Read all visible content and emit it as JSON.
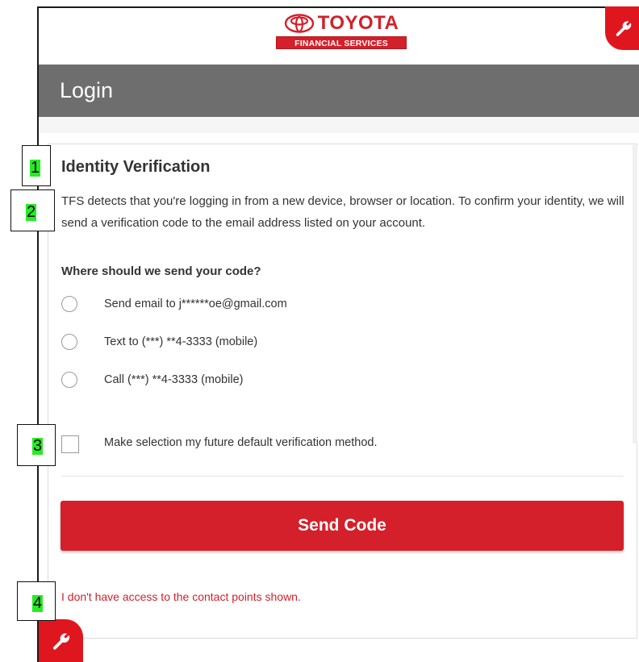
{
  "logo": {
    "brand": "TOYOTA",
    "sub": "FINANCIAL SERVICES"
  },
  "header": {
    "title": "Login"
  },
  "verification": {
    "heading": "Identity Verification",
    "description": "TFS detects that you're logging in from a new device, browser or location. To confirm your identity, we will send a verification code to the email address listed on your account.",
    "question": "Where should we send your code?",
    "options": [
      {
        "label": "Send email to j******oe@gmail.com"
      },
      {
        "label": "Text to (***) **4-3333 (mobile)"
      },
      {
        "label": "Call (***) **4-3333 (mobile)"
      }
    ],
    "default_checkbox_label": "Make selection my future default verification method.",
    "send_button": "Send Code",
    "no_access_link": "I don't have access to the contact points shown."
  },
  "callouts": [
    "1",
    "2",
    "3",
    "4"
  ],
  "icons": {
    "wrench_top": "wrench-icon",
    "wrench_bottom": "wrench-icon",
    "logo": "toyota-emblem-icon"
  },
  "colors": {
    "brand_red": "#d3202a",
    "header_gray": "#6e6e6e",
    "callout_green": "#22ee22"
  }
}
